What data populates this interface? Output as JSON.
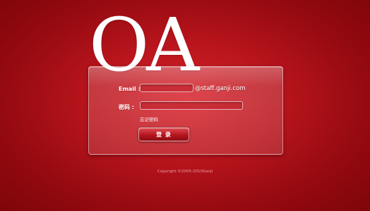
{
  "logo": {
    "text": "OA"
  },
  "form": {
    "email_label": "Email :",
    "email_value": "",
    "email_suffix": "@staff.ganji.com",
    "password_label": "密码 :",
    "password_value": "",
    "forgot_link": "忘记密码",
    "login_button": "登 录"
  },
  "footer": {
    "copyright": "Copyright ©2005-2010Ganji"
  },
  "colors": {
    "background": "#b8141c",
    "accent": "#d8232b"
  }
}
